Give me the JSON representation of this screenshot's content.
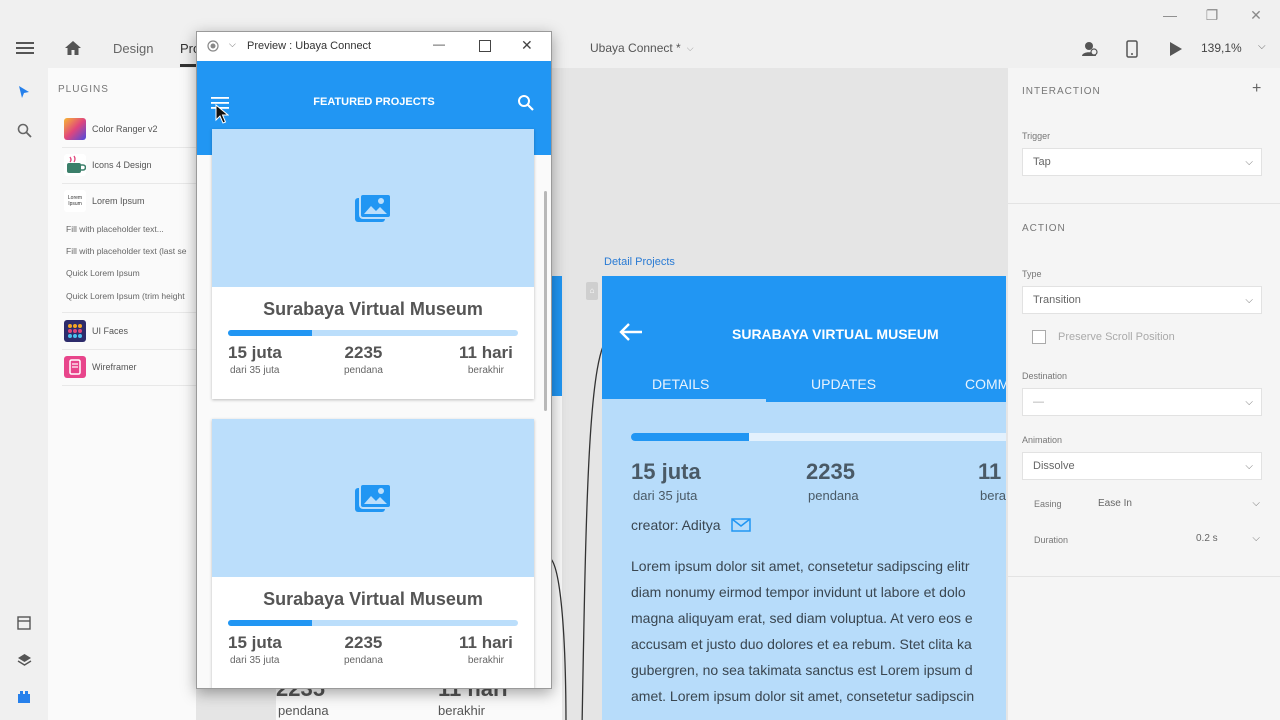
{
  "app": {
    "window_controls": {
      "minimize": "—",
      "restore": "❐",
      "close": "✕"
    },
    "toolbar": {
      "menu_icon": "hamburger-icon",
      "home_icon": "home-icon",
      "tab_design": "Design",
      "tab_prototype": "Pro",
      "doc_title": "Ubaya Connect *",
      "zoom": "139,1%"
    }
  },
  "plugins": {
    "heading": "PLUGINS",
    "items": [
      {
        "label": "Color Ranger v2",
        "color": "#e0467c"
      },
      {
        "label": "Icons 4 Design",
        "color": "#3b7f6a"
      },
      {
        "label": "Lorem Ipsum",
        "color": "#ffffff"
      }
    ],
    "lorem_actions": [
      "Fill with placeholder text...",
      "Fill with placeholder text (last se",
      "Quick Lorem Ipsum",
      "Quick Lorem Ipsum (trim height"
    ],
    "more_items": [
      {
        "label": "UI Faces",
        "color": "#2d2b6b"
      },
      {
        "label": "Wireframer",
        "color": "#e8458b"
      }
    ]
  },
  "canvas": {
    "detail_label": "Detail Projects",
    "detail": {
      "title": "SURABAYA VIRTUAL MUSEUM",
      "tabs": [
        "DETAILS",
        "UPDATES",
        "COMM"
      ],
      "progress": 0.31,
      "stats": [
        {
          "value": "15 juta",
          "label": "dari 35 juta"
        },
        {
          "value": "2235",
          "label": "pendana"
        },
        {
          "value": "11",
          "label": "bera"
        }
      ],
      "creator": "creator: Aditya",
      "lorem_lines": [
        "Lorem ipsum dolor sit amet, consetetur sadipscing elitr",
        "diam nonumy eirmod tempor invidunt ut labore et dolo",
        "magna aliquyam erat, sed diam voluptua. At vero eos e",
        "accusam et justo duo dolores et ea rebum. Stet clita ka",
        "gubergren, no sea takimata sanctus est Lorem ipsum d",
        "amet. Lorem ipsum dolor sit amet, consetetur sadipscin"
      ]
    },
    "bg_board": {
      "stat_value_1": "2235",
      "stat_value_2": "11 hari",
      "stat_label_1": "pendana",
      "stat_label_2": "berakhir"
    }
  },
  "interaction": {
    "heading": "INTERACTION",
    "add": "+",
    "trigger_label": "Trigger",
    "trigger_value": "Tap",
    "action_heading": "ACTION",
    "type_label": "Type",
    "type_value": "Transition",
    "preserve_scroll": "Preserve Scroll Position",
    "destination_label": "Destination",
    "destination_value": "—",
    "animation_label": "Animation",
    "animation_value": "Dissolve",
    "easing_label": "Easing",
    "easing_value": "Ease In",
    "duration_label": "Duration",
    "duration_value": "0.2 s"
  },
  "preview": {
    "window_title": "Preview : Ubaya Connect",
    "header_title": "FEATURED PROJECTS",
    "cards": [
      {
        "title": "Surabaya Virtual Museum",
        "progress": 0.29,
        "stats": [
          {
            "value": "15 juta",
            "label": "dari 35 juta"
          },
          {
            "value": "2235",
            "label": "pendana"
          },
          {
            "value": "11 hari",
            "label": "berakhir"
          }
        ]
      },
      {
        "title": "Surabaya Virtual Museum",
        "progress": 0.29,
        "stats": [
          {
            "value": "15 juta",
            "label": "dari 35 juta"
          },
          {
            "value": "2235",
            "label": "pendana"
          },
          {
            "value": "11 hari",
            "label": "berakhir"
          }
        ]
      }
    ]
  }
}
